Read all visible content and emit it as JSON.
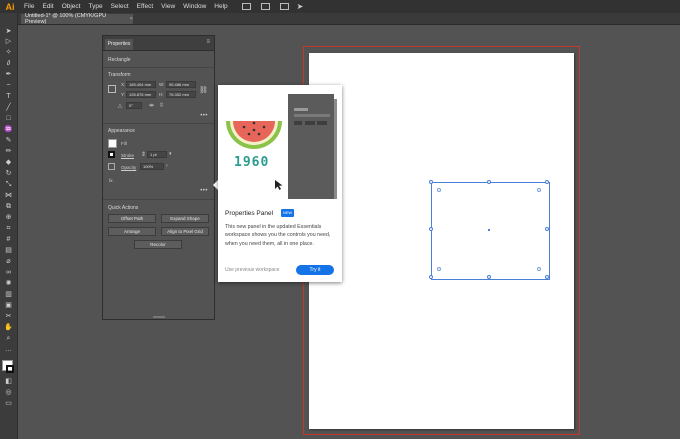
{
  "app": {
    "logo": "Ai",
    "menu": [
      "File",
      "Edit",
      "Object",
      "Type",
      "Select",
      "Effect",
      "View",
      "Window",
      "Help"
    ]
  },
  "document_tab": {
    "title": "Untitled-1* @ 100% (CMYK/GPU Preview)",
    "close": "×"
  },
  "properties_panel": {
    "tab_label": "Properties",
    "menu_icon": "≡",
    "object_type": "Rectangle",
    "transform": {
      "title": "Transform",
      "x_label": "X:",
      "x_value": "165.404 mm",
      "y_label": "Y:",
      "y_value": "126.876 mm",
      "w_label": "W:",
      "w_value": "95.486 mm",
      "h_label": "H:",
      "h_value": "76.352 mm",
      "angle_value": "0°"
    },
    "appearance": {
      "title": "Appearance",
      "fill_label": "Fill",
      "stroke_label": "Stroke",
      "stroke_value": "1 pt",
      "opacity_label": "Opacity",
      "opacity_value": "100%",
      "fx_label": "fx."
    },
    "more_label": "•••",
    "quick_actions": {
      "title": "Quick Actions",
      "offset_path": "Offset Path",
      "expand_shape": "Expand Shape",
      "arrange": "Arrange",
      "align_pixel_grid": "Align to Pixel Grid",
      "recolor": "Recolor"
    }
  },
  "popup": {
    "illustration_year": "1960",
    "title": "Properties Panel",
    "badge": "NEW",
    "body": "This new panel in the updated Essentials workspace shows you the controls you need, when you need them, all in one place.",
    "link": "Use previous workspace",
    "button": "Try it"
  },
  "colors": {
    "accent": "#1473e6",
    "selection": "#4a7fd8",
    "artboard_bleed": "#c0392b",
    "logo": "#ff9a00"
  }
}
